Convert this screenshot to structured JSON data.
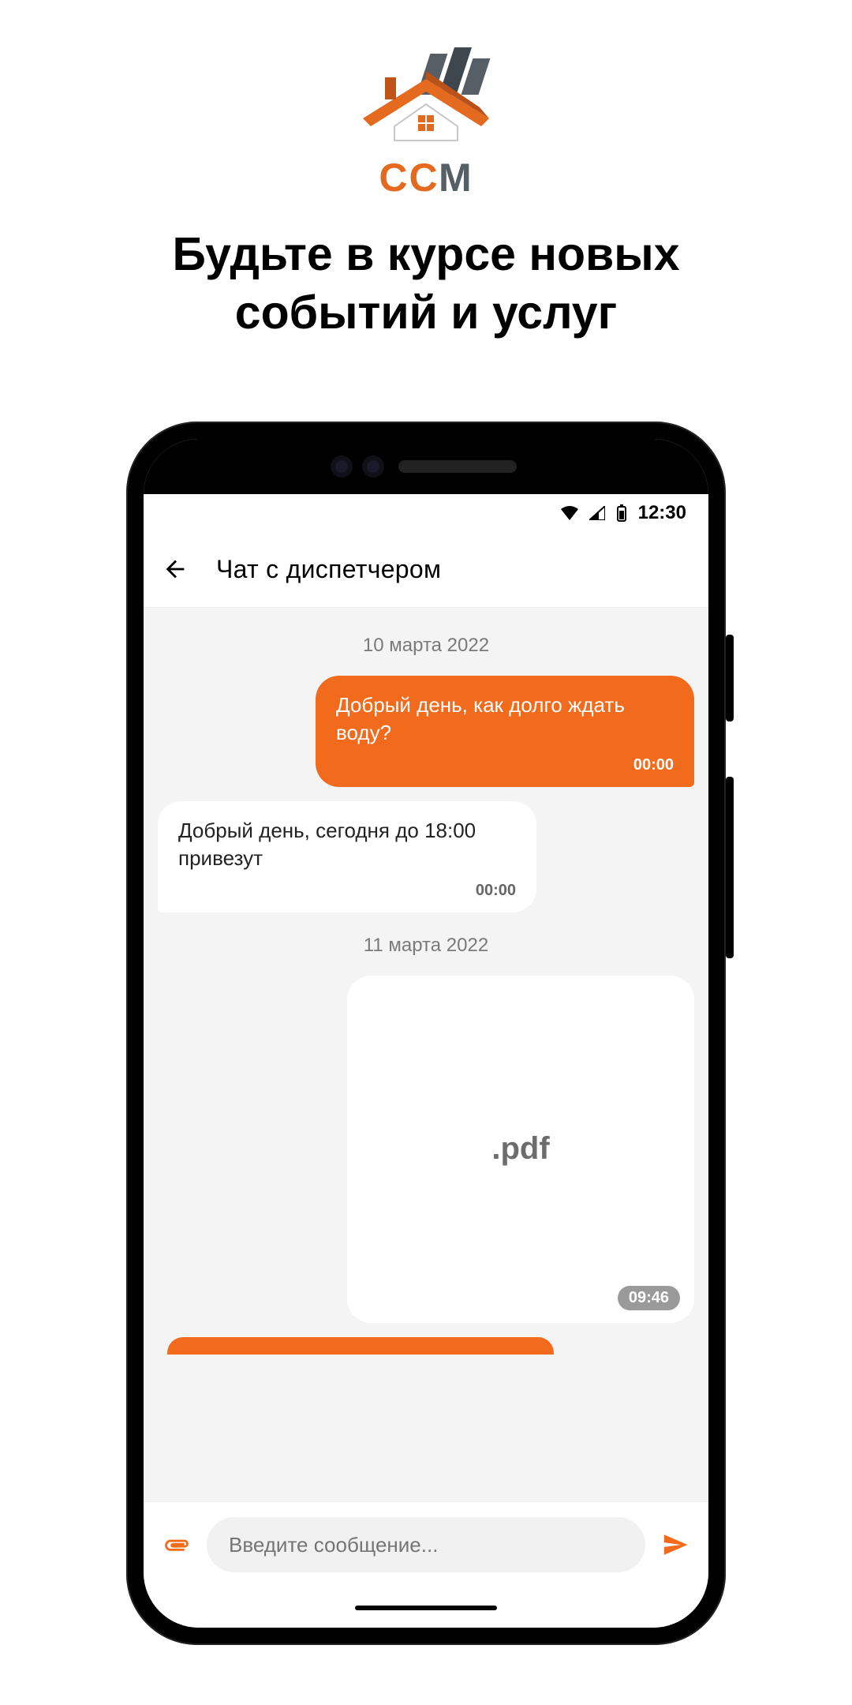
{
  "logo_text": {
    "c1": "С",
    "c2": "С",
    "c3": "М"
  },
  "headline_line1": "Будьте в курсе новых",
  "headline_line2": "событий и услуг",
  "statusbar": {
    "time": "12:30"
  },
  "app_header": {
    "title": "Чат с диспетчером"
  },
  "chat": {
    "date1": "10 марта 2022",
    "msg1": {
      "text": "Добрый день, как долго ждать воду?",
      "time": "00:00"
    },
    "msg2": {
      "text": "Добрый день, сегодня до 18:00 привезут",
      "time": "00:00"
    },
    "date2": "11 марта 2022",
    "attachment": {
      "ext": ".pdf",
      "time": "09:46"
    }
  },
  "composer": {
    "placeholder": "Введите сообщение..."
  },
  "colors": {
    "accent": "#f26a1b"
  }
}
